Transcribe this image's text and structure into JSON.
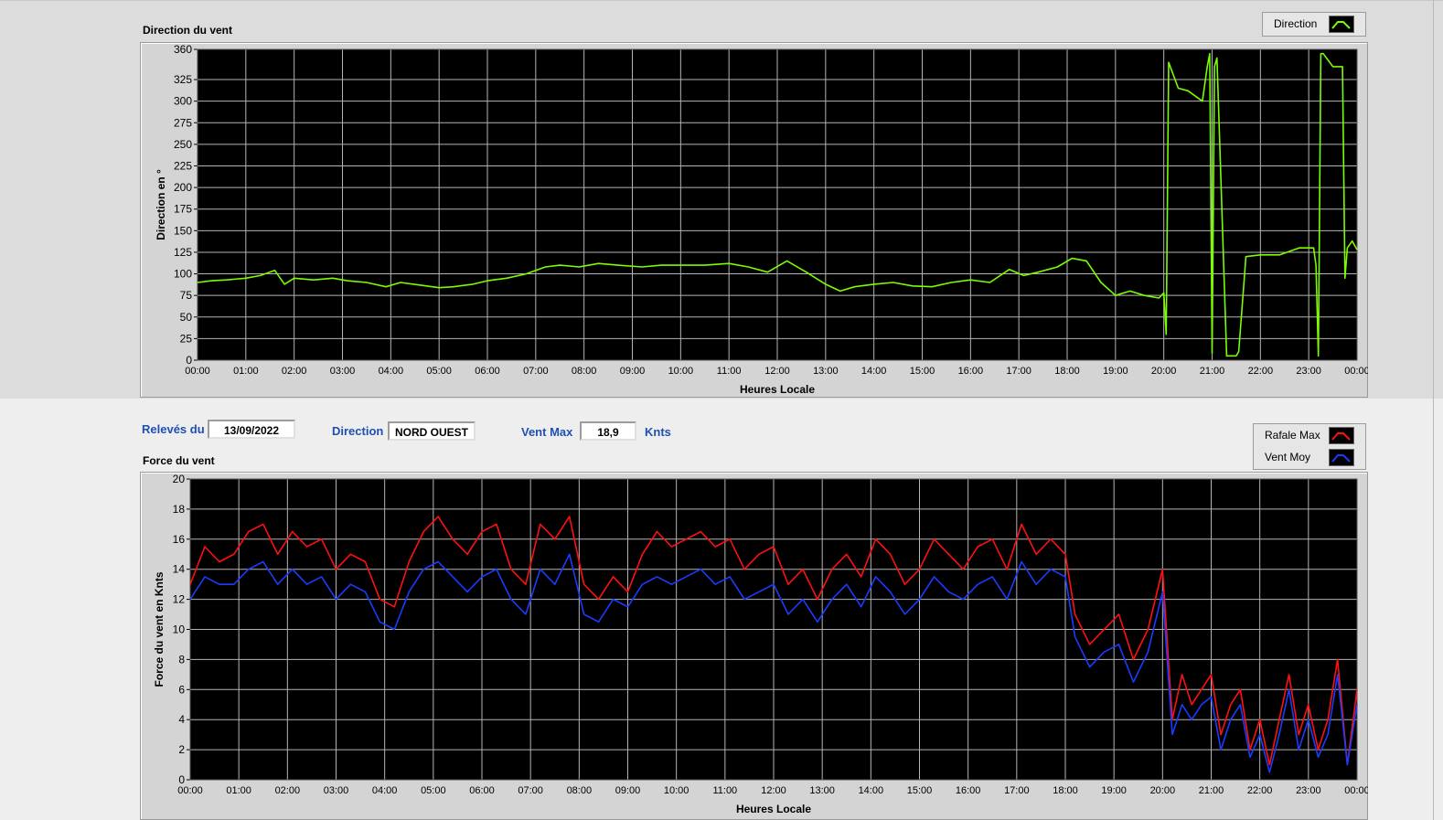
{
  "top_panel": {
    "title": "Direction du vent",
    "legend": [
      {
        "label": "Direction",
        "color": "#7cfc00",
        "icon": "line-swatch-icon"
      }
    ]
  },
  "info": {
    "date_label": "Relevés du",
    "date_value": "13/09/2022",
    "direction_label": "Direction",
    "direction_value": "NORD OUEST",
    "ventmax_label": "Vent Max",
    "ventmax_value": "18,9",
    "ventmax_unit": "Knts"
  },
  "bottom_panel": {
    "title": "Force du vent",
    "legend": [
      {
        "label": "Rafale Max",
        "color": "#ff1010",
        "icon": "line-swatch-icon"
      },
      {
        "label": "Vent Moy",
        "color": "#1a3cff",
        "icon": "line-swatch-icon"
      }
    ]
  },
  "colors": {
    "plot_bg": "#000000",
    "grid": "#b4b4b4",
    "direction": "#7cfc00",
    "gust": "#ff1010",
    "avg": "#1a3cff"
  },
  "chart_data": [
    {
      "type": "line",
      "title": "",
      "xlabel": "Heures Locale",
      "ylabel": "Direction en °",
      "xlim": [
        0,
        24
      ],
      "ylim": [
        0,
        360
      ],
      "x_ticks": [
        "00:00",
        "01:00",
        "02:00",
        "03:00",
        "04:00",
        "05:00",
        "06:00",
        "07:00",
        "08:00",
        "09:00",
        "10:00",
        "11:00",
        "12:00",
        "13:00",
        "14:00",
        "15:00",
        "16:00",
        "17:00",
        "18:00",
        "19:00",
        "20:00",
        "21:00",
        "22:00",
        "23:00",
        "00:00"
      ],
      "y_ticks": [
        0,
        25,
        50,
        75,
        100,
        125,
        150,
        175,
        200,
        225,
        250,
        275,
        300,
        325,
        360
      ],
      "grid": true,
      "legend_position": "top-right",
      "series": [
        {
          "name": "Direction",
          "x": [
            0,
            0.3,
            0.6,
            1.0,
            1.3,
            1.6,
            1.8,
            2.0,
            2.4,
            2.8,
            3.1,
            3.5,
            3.9,
            4.2,
            4.6,
            5.0,
            5.3,
            5.7,
            6.0,
            6.4,
            6.8,
            7.2,
            7.5,
            7.9,
            8.3,
            8.7,
            9.2,
            9.6,
            10.0,
            10.5,
            11.0,
            11.4,
            11.8,
            12.2,
            12.6,
            13.0,
            13.3,
            13.6,
            14.0,
            14.4,
            14.8,
            15.2,
            15.6,
            16.0,
            16.4,
            16.8,
            17.1,
            17.4,
            17.8,
            18.1,
            18.4,
            18.7,
            19.0,
            19.3,
            19.6,
            19.9,
            20.0,
            20.05,
            20.1,
            20.3,
            20.5,
            20.8,
            20.9,
            20.95,
            21.0,
            21.05,
            21.1,
            21.3,
            21.5,
            21.55,
            21.7,
            22.0,
            22.4,
            22.8,
            23.1,
            23.15,
            23.2,
            23.25,
            23.3,
            23.5,
            23.7,
            23.75,
            23.8,
            23.9,
            24.0
          ],
          "values": [
            90,
            92,
            93,
            95,
            98,
            104,
            88,
            95,
            93,
            95,
            92,
            90,
            85,
            90,
            87,
            84,
            85,
            88,
            92,
            95,
            100,
            108,
            110,
            108,
            112,
            110,
            108,
            110,
            110,
            110,
            112,
            108,
            102,
            115,
            102,
            88,
            80,
            85,
            88,
            90,
            86,
            85,
            90,
            93,
            90,
            105,
            98,
            102,
            108,
            118,
            115,
            90,
            75,
            80,
            75,
            72,
            78,
            30,
            345,
            315,
            312,
            300,
            340,
            355,
            8,
            340,
            350,
            5,
            5,
            10,
            120,
            122,
            122,
            130,
            130,
            110,
            5,
            355,
            355,
            340,
            340,
            95,
            130,
            138,
            128
          ]
        }
      ]
    },
    {
      "type": "line",
      "title": "",
      "xlabel": "Heures Locale",
      "ylabel": "Force du vent en Knts",
      "xlim": [
        0,
        24
      ],
      "ylim": [
        0,
        20
      ],
      "x_ticks": [
        "00:00",
        "01:00",
        "02:00",
        "03:00",
        "04:00",
        "05:00",
        "06:00",
        "07:00",
        "08:00",
        "09:00",
        "10:00",
        "11:00",
        "12:00",
        "13:00",
        "14:00",
        "15:00",
        "16:00",
        "17:00",
        "18:00",
        "19:00",
        "20:00",
        "21:00",
        "22:00",
        "23:00",
        "00:00"
      ],
      "y_ticks": [
        0,
        2,
        4,
        6,
        8,
        10,
        12,
        14,
        16,
        18,
        20
      ],
      "grid": true,
      "legend_position": "top-right",
      "series": [
        {
          "name": "Rafale Max",
          "x": [
            0,
            0.3,
            0.6,
            0.9,
            1.2,
            1.5,
            1.8,
            2.1,
            2.4,
            2.7,
            3.0,
            3.3,
            3.6,
            3.9,
            4.2,
            4.5,
            4.8,
            5.1,
            5.4,
            5.7,
            6.0,
            6.3,
            6.6,
            6.9,
            7.2,
            7.5,
            7.8,
            8.1,
            8.4,
            8.7,
            9.0,
            9.3,
            9.6,
            9.9,
            10.2,
            10.5,
            10.8,
            11.1,
            11.4,
            11.7,
            12.0,
            12.3,
            12.6,
            12.9,
            13.2,
            13.5,
            13.8,
            14.1,
            14.4,
            14.7,
            15.0,
            15.3,
            15.6,
            15.9,
            16.2,
            16.5,
            16.8,
            17.1,
            17.4,
            17.7,
            18.0,
            18.2,
            18.5,
            18.8,
            19.1,
            19.4,
            19.7,
            20.0,
            20.2,
            20.4,
            20.6,
            20.8,
            21.0,
            21.2,
            21.4,
            21.6,
            21.8,
            22.0,
            22.2,
            22.4,
            22.6,
            22.8,
            23.0,
            23.2,
            23.4,
            23.6,
            23.8,
            24.0
          ],
          "values": [
            13,
            15.5,
            14.5,
            15,
            16.5,
            17,
            15,
            16.5,
            15.5,
            16,
            14,
            15,
            14.5,
            12,
            11.5,
            14.5,
            16.5,
            17.5,
            16,
            15,
            16.5,
            17,
            14,
            13,
            17,
            16,
            17.5,
            13,
            12,
            13.5,
            12.5,
            15,
            16.5,
            15.5,
            16,
            16.5,
            15.5,
            16,
            14,
            15,
            15.5,
            13,
            14,
            12,
            14,
            15,
            13.5,
            16,
            15,
            13,
            14,
            16,
            15,
            14,
            15.5,
            16,
            14,
            17,
            15,
            16,
            15,
            11,
            9,
            10,
            11,
            8,
            10,
            14,
            4,
            7,
            5,
            6,
            7,
            3,
            5,
            6,
            2,
            4,
            1,
            4,
            7,
            3,
            5,
            2,
            4,
            8,
            1,
            6
          ]
        },
        {
          "name": "Vent Moy",
          "x": [
            0,
            0.3,
            0.6,
            0.9,
            1.2,
            1.5,
            1.8,
            2.1,
            2.4,
            2.7,
            3.0,
            3.3,
            3.6,
            3.9,
            4.2,
            4.5,
            4.8,
            5.1,
            5.4,
            5.7,
            6.0,
            6.3,
            6.6,
            6.9,
            7.2,
            7.5,
            7.8,
            8.1,
            8.4,
            8.7,
            9.0,
            9.3,
            9.6,
            9.9,
            10.2,
            10.5,
            10.8,
            11.1,
            11.4,
            11.7,
            12.0,
            12.3,
            12.6,
            12.9,
            13.2,
            13.5,
            13.8,
            14.1,
            14.4,
            14.7,
            15.0,
            15.3,
            15.6,
            15.9,
            16.2,
            16.5,
            16.8,
            17.1,
            17.4,
            17.7,
            18.0,
            18.2,
            18.5,
            18.8,
            19.1,
            19.4,
            19.7,
            20.0,
            20.2,
            20.4,
            20.6,
            20.8,
            21.0,
            21.2,
            21.4,
            21.6,
            21.8,
            22.0,
            22.2,
            22.4,
            22.6,
            22.8,
            23.0,
            23.2,
            23.4,
            23.6,
            23.8,
            24.0
          ],
          "values": [
            12,
            13.5,
            13,
            13,
            14,
            14.5,
            13,
            14,
            13,
            13.5,
            12,
            13,
            12.5,
            10.5,
            10,
            12.5,
            14,
            14.5,
            13.5,
            12.5,
            13.5,
            14,
            12,
            11,
            14,
            13,
            15,
            11,
            10.5,
            12,
            11.5,
            13,
            13.5,
            13,
            13.5,
            14,
            13,
            13.5,
            12,
            12.5,
            13,
            11,
            12,
            10.5,
            12,
            13,
            11.5,
            13.5,
            12.5,
            11,
            12,
            13.5,
            12.5,
            12,
            13,
            13.5,
            12,
            14.5,
            13,
            14,
            13.5,
            9.5,
            7.5,
            8.5,
            9,
            6.5,
            8.5,
            12.5,
            3,
            5,
            4,
            5,
            5.5,
            2,
            4,
            5,
            1.5,
            3,
            0.5,
            3,
            6,
            2,
            4,
            1.5,
            3,
            7,
            1,
            5
          ]
        }
      ]
    }
  ]
}
